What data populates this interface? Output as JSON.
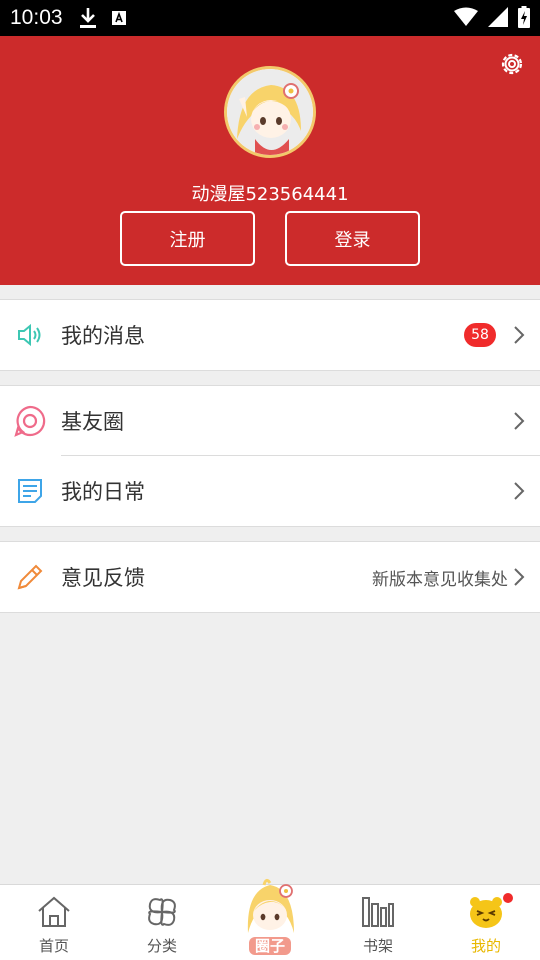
{
  "status_bar": {
    "time": "10:03"
  },
  "header": {
    "username": "动漫屋523564441",
    "register_label": "注册",
    "login_label": "登录"
  },
  "menu": {
    "messages": {
      "label": "我的消息",
      "badge": "58"
    },
    "circle": {
      "label": "基友圈"
    },
    "daily": {
      "label": "我的日常"
    },
    "feedback": {
      "label": "意见反馈",
      "hint": "新版本意见收集处"
    }
  },
  "bottom_nav": {
    "home": "首页",
    "category": "分类",
    "circle": "圈子",
    "bookshelf": "书架",
    "mine": "我的"
  },
  "colors": {
    "header_bg": "#cc2b2b",
    "badge_bg": "#f02b2b",
    "active_tab": "#e8b800"
  }
}
